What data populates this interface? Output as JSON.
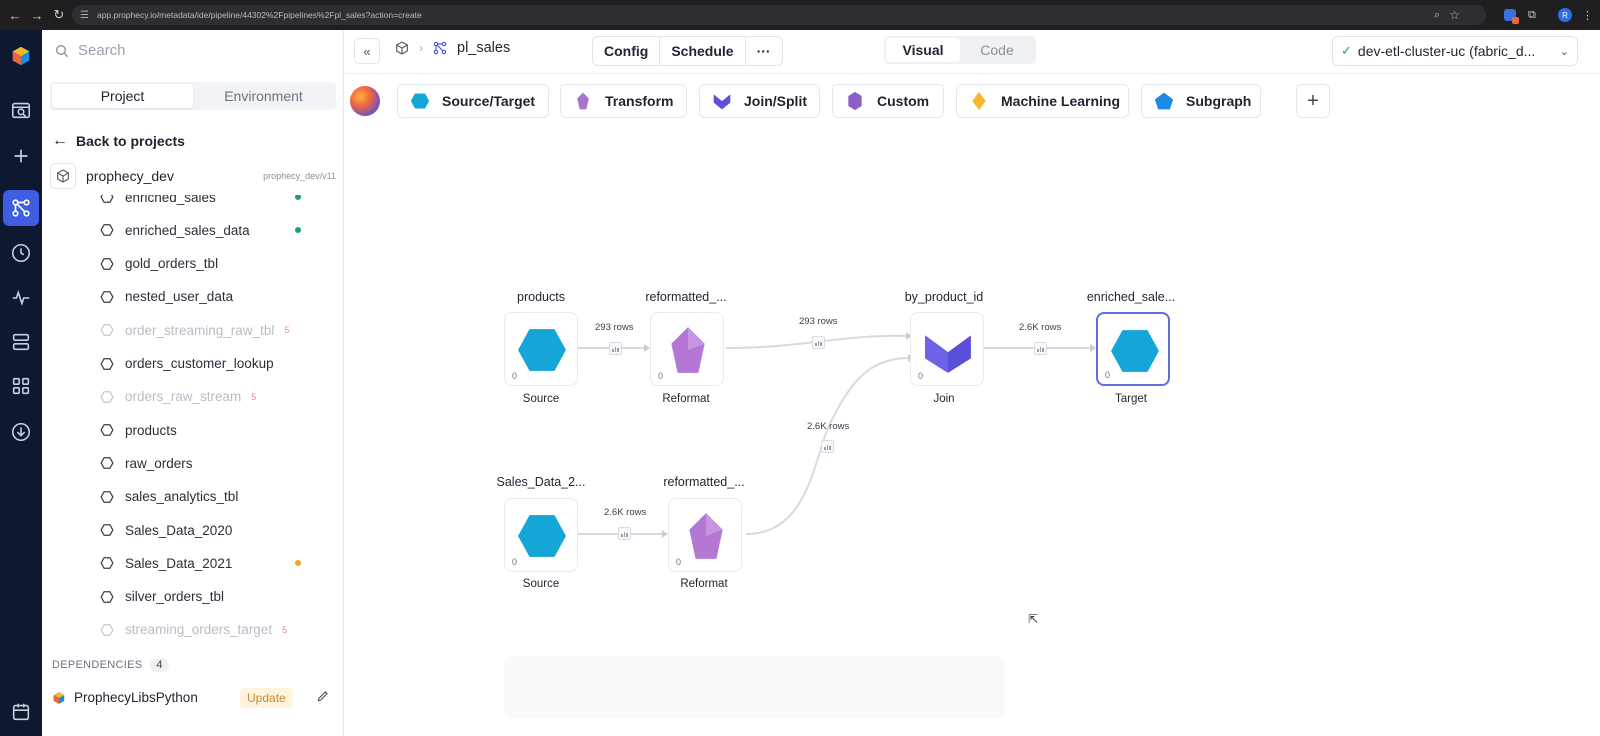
{
  "browser": {
    "url": "app.prophecy.io/metadata/ide/pipeline/44302%2Fpipelines%2Fpl_sales?action=create",
    "profile_initial": "R"
  },
  "sidebar": {
    "search_placeholder": "Search",
    "tabs": [
      "Project",
      "Environment"
    ],
    "active_tab": "Project",
    "back_label": "Back to projects",
    "project_name": "prophecy_dev",
    "project_branch": "prophecy_dev/v11",
    "datasets": [
      {
        "name": "enriched_sales",
        "dim": false,
        "count": "",
        "dot": "#1a9e8a"
      },
      {
        "name": "enriched_sales_data",
        "dim": false,
        "count": "",
        "dot": "#1a9e8a"
      },
      {
        "name": "gold_orders_tbl",
        "dim": false,
        "count": "",
        "dot": ""
      },
      {
        "name": "nested_user_data",
        "dim": false,
        "count": "",
        "dot": ""
      },
      {
        "name": "order_streaming_raw_tbl",
        "dim": true,
        "count": "5",
        "dot": ""
      },
      {
        "name": "orders_customer_lookup",
        "dim": false,
        "count": "",
        "dot": ""
      },
      {
        "name": "orders_raw_stream",
        "dim": true,
        "count": "5",
        "dot": ""
      },
      {
        "name": "products",
        "dim": false,
        "count": "",
        "dot": ""
      },
      {
        "name": "raw_orders",
        "dim": false,
        "count": "",
        "dot": ""
      },
      {
        "name": "sales_analytics_tbl",
        "dim": false,
        "count": "",
        "dot": ""
      },
      {
        "name": "Sales_Data_2020",
        "dim": false,
        "count": "",
        "dot": ""
      },
      {
        "name": "Sales_Data_2021",
        "dim": false,
        "count": "",
        "dot": "#f5a524"
      },
      {
        "name": "silver_orders_tbl",
        "dim": false,
        "count": "",
        "dot": ""
      },
      {
        "name": "streaming_orders_target",
        "dim": true,
        "count": "5",
        "dot": ""
      }
    ],
    "dependencies_label": "DEPENDENCIES",
    "dependencies_count": "4",
    "dependency": {
      "name": "ProphecyLibsPython",
      "action": "Update"
    }
  },
  "topbar": {
    "pipeline_name": "pl_sales",
    "config_label": "Config",
    "schedule_label": "Schedule",
    "more_label": "···",
    "view_tabs": [
      "Visual",
      "Code"
    ],
    "active_view": "Visual",
    "cluster": "dev-etl-cluster-uc (fabric_d..."
  },
  "palette": {
    "items": [
      {
        "label": "Source/Target",
        "icon": "hexagon-icon",
        "color": "#13a6d6"
      },
      {
        "label": "Transform",
        "icon": "crystal-icon",
        "color": "#a974cf"
      },
      {
        "label": "Join/Split",
        "icon": "chevron-icon",
        "color": "#5d52d6"
      },
      {
        "label": "Custom",
        "icon": "gem-icon",
        "color": "#8e5fc9"
      },
      {
        "label": "Machine Learning",
        "icon": "diamond-icon",
        "color": "#f6b72c"
      },
      {
        "label": "Subgraph",
        "icon": "pentagon-icon",
        "color": "#1b8ae8"
      }
    ]
  },
  "graph": {
    "nodes": [
      {
        "id": "n1",
        "title": "products",
        "type": "Source",
        "count": "0",
        "kind": "source"
      },
      {
        "id": "n2",
        "title": "reformatted_...",
        "type": "Reformat",
        "count": "0",
        "kind": "reformat"
      },
      {
        "id": "n3",
        "title": "by_product_id",
        "type": "Join",
        "count": "0",
        "kind": "join"
      },
      {
        "id": "n4",
        "title": "enriched_sale...",
        "type": "Target",
        "count": "0",
        "kind": "target"
      },
      {
        "id": "n5",
        "title": "Sales_Data_2...",
        "type": "Source",
        "count": "0",
        "kind": "source"
      },
      {
        "id": "n6",
        "title": "reformatted_...",
        "type": "Reformat",
        "count": "0",
        "kind": "reformat"
      }
    ],
    "edges": [
      {
        "from": "n1",
        "to": "n2",
        "rows": "293 rows"
      },
      {
        "from": "n2",
        "to": "n3",
        "rows": "293 rows"
      },
      {
        "from": "n3",
        "to": "n4",
        "rows": "2.6K rows"
      },
      {
        "from": "n5",
        "to": "n6",
        "rows": "2.6K rows"
      },
      {
        "from": "n6",
        "to": "n3",
        "rows": "2.6K rows"
      }
    ]
  },
  "colors": {
    "rail_bg": "#0e1830",
    "rail_active": "#3f5de3",
    "source_hex": "#13a6d6",
    "reformat": "#b478d4",
    "join": "#5a4fd8",
    "selected_border": "#5b6ee1"
  }
}
